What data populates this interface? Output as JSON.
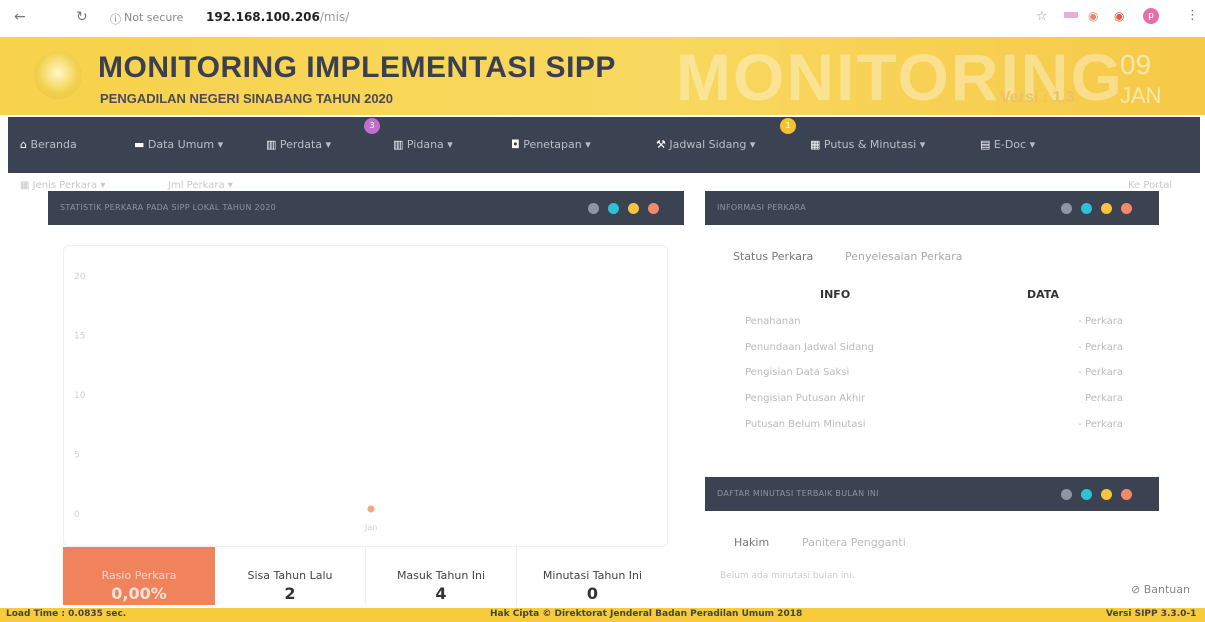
{
  "browser": {
    "security": "Not secure",
    "url_host": "192.168.100.206",
    "url_path": "/mis/"
  },
  "header": {
    "title": "MONITORING IMPLEMENTASI SIPP",
    "subtitle": "PENGADILAN NEGERI SINABANG TAHUN 2020",
    "watermark": "MONITORING",
    "version": "Versi : 1.3",
    "day": "09",
    "month": "JAN"
  },
  "nav": {
    "items": [
      {
        "label": "Beranda",
        "icon": "home-icon"
      },
      {
        "label": "Data Umum ▾",
        "icon": "folder-icon"
      },
      {
        "label": "Perdata ▾",
        "icon": "bank-icon",
        "badge": "3"
      },
      {
        "label": "Pidana ▾",
        "icon": "bank-icon"
      },
      {
        "label": "Penetapan ▾",
        "icon": "square-icon"
      },
      {
        "label": "Jadwal Sidang ▾",
        "icon": "gavel-icon",
        "badge": "1"
      },
      {
        "label": "Putus & Minutasi ▾",
        "icon": "calendar-icon"
      },
      {
        "label": "E-Doc ▾",
        "icon": "document-icon"
      }
    ],
    "colors": {
      "badge_purple": "#c06fc9",
      "badge_yellow": "#f3c233"
    }
  },
  "crumbs": {
    "left": "Jenis Perkara ▾",
    "mid": "Jml Perkara ▾",
    "right": "Ke Portal"
  },
  "stats_panel": {
    "title": "STATISTIK PERKARA PADA SIPP LOKAL TAHUN 2020",
    "stats": [
      {
        "label": "Rasio Perkara",
        "value": "0,00%"
      },
      {
        "label": "Sisa Tahun Lalu",
        "value": "2"
      },
      {
        "label": "Masuk Tahun Ini",
        "value": "4"
      },
      {
        "label": "Minutasi Tahun Ini",
        "value": "0"
      }
    ]
  },
  "chart_data": {
    "type": "line",
    "title": "",
    "xlabel": "",
    "ylabel": "",
    "categories": [
      "Jan"
    ],
    "y_ticks": [
      "20",
      "15",
      "10",
      "5",
      "0"
    ],
    "ylim": [
      0,
      20
    ],
    "series": [
      {
        "values": [
          0
        ],
        "color": "#f4a77c"
      }
    ]
  },
  "info_panel": {
    "title": "INFORMASI PERKARA",
    "tabs": [
      "Status Perkara",
      "Penyelesaian Perkara"
    ],
    "col_info": "INFO",
    "col_data": "DATA",
    "rows": [
      {
        "label": "Penahanan",
        "value": "- Perkara"
      },
      {
        "label": "Penundaan Jadwal Sidang",
        "value": "- Perkara"
      },
      {
        "label": "Pengisian Data Saksi",
        "value": "- Perkara"
      },
      {
        "label": "Pengisian Putusan Akhir",
        "value": "Perkara"
      },
      {
        "label": "Putusan Belum Minutasi",
        "value": "- Perkara"
      }
    ]
  },
  "minutasi_panel": {
    "title": "DAFTAR MINUTASI TERBAIK BULAN INI",
    "tabs": [
      "Hakim",
      "Panitera Pengganti"
    ],
    "empty": "Belum ada minutasi bulan ini."
  },
  "help": "Bantuan",
  "footer": {
    "load_time": "Load Time : 0.0835 sec.",
    "copyright": "Hak Cipta © Direktorat Jenderal Badan Peradilan Umum 2018",
    "version": "Versi SIPP 3.3.0-1"
  },
  "panel_dot_colors": [
    "#8f96a3",
    "#2fc1d6",
    "#f7c340",
    "#f28a6a"
  ]
}
